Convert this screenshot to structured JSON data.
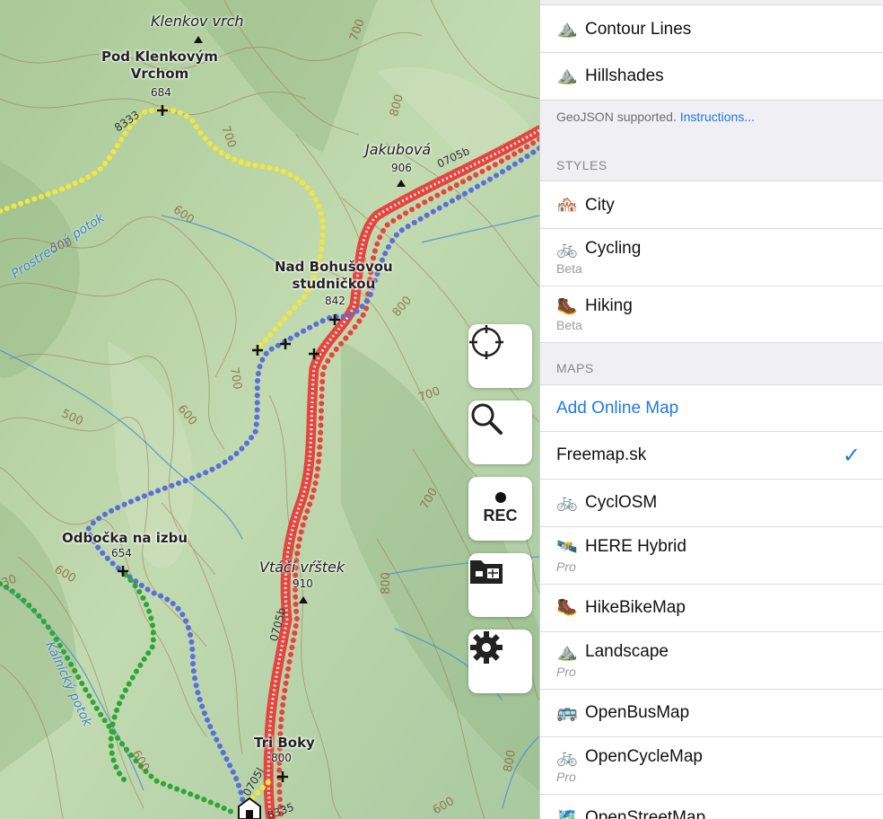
{
  "map": {
    "peaks": [
      {
        "name": "Pod Klenkovým\nVrchom",
        "elevation": "684"
      },
      {
        "name": "Nad Bohušovou\nstudničkou",
        "elevation": "842"
      },
      {
        "name": "Odbočka na izbu",
        "elevation": "654"
      },
      {
        "name": "Tri Boky",
        "elevation": "800"
      }
    ],
    "hills": [
      {
        "name": "Klenkov vrch"
      },
      {
        "name": "Jakubová",
        "elevation": "906"
      },
      {
        "name": "Vtáčí vŕštek",
        "elevation": "910"
      }
    ],
    "streams": [
      "Prostredný potok",
      "Kálnický potok"
    ],
    "route_codes": [
      "8333",
      "0705b",
      "0705b",
      "0705l",
      "8335"
    ],
    "contour_values": [
      "700",
      "800",
      "600",
      "500",
      "700",
      "600",
      "700",
      "800",
      "700",
      "500",
      "600",
      "600",
      "700",
      "800",
      "800",
      "600",
      "30"
    ],
    "controls": {
      "locate_icon": "crosshair-icon",
      "search_icon": "magnifier-icon",
      "rec_label": "REC",
      "folder_icon": "map-folder-icon",
      "settings_icon": "gear-icon"
    }
  },
  "panel": {
    "overlays": [
      {
        "icon": "mountain-icon",
        "glyph": "⛰️",
        "label": "Contour Lines"
      },
      {
        "icon": "mountain-icon",
        "glyph": "⛰️",
        "label": "Hillshades"
      }
    ],
    "geojson_note": "GeoJSON supported.",
    "geojson_link": "Instructions...",
    "styles_header": "STYLES",
    "styles": [
      {
        "icon": "houses-icon",
        "glyph": "🏘️",
        "label": "City",
        "sub": ""
      },
      {
        "icon": "bicycle-icon",
        "glyph": "🚲",
        "label": "Cycling",
        "sub": "Beta"
      },
      {
        "icon": "hiking-boot-icon",
        "glyph": "🥾",
        "label": "Hiking",
        "sub": "Beta"
      }
    ],
    "maps_header": "MAPS",
    "add_online_map": "Add Online Map",
    "freemap_label": "Freemap.sk",
    "freemap_selected": "✓",
    "maps": [
      {
        "icon": "bicycle-icon",
        "glyph": "🚲",
        "label": "CyclOSM",
        "sub": ""
      },
      {
        "icon": "satellite-icon",
        "glyph": "🛰️",
        "label": "HERE Hybrid",
        "sub": "Pro"
      },
      {
        "icon": "hiking-boot-icon",
        "glyph": "🥾",
        "label": "HikeBikeMap",
        "sub": ""
      },
      {
        "icon": "mountain-icon",
        "glyph": "⛰️",
        "label": "Landscape",
        "sub": "Pro"
      },
      {
        "icon": "bus-icon",
        "glyph": "🚌",
        "label": "OpenBusMap",
        "sub": ""
      },
      {
        "icon": "bicycle-icon",
        "glyph": "🚲",
        "label": "OpenCycleMap",
        "sub": "Pro"
      },
      {
        "icon": "map-icon",
        "glyph": "🗺️",
        "label": "OpenStreetMap",
        "sub": ""
      }
    ]
  },
  "colors": {
    "accent": "#1f7ae0",
    "route_red": "#e4463f",
    "route_blue": "#5b6fd6",
    "route_yellow": "#f2e640",
    "route_green": "#2fa53a",
    "terrain": "#b9d3a7"
  }
}
